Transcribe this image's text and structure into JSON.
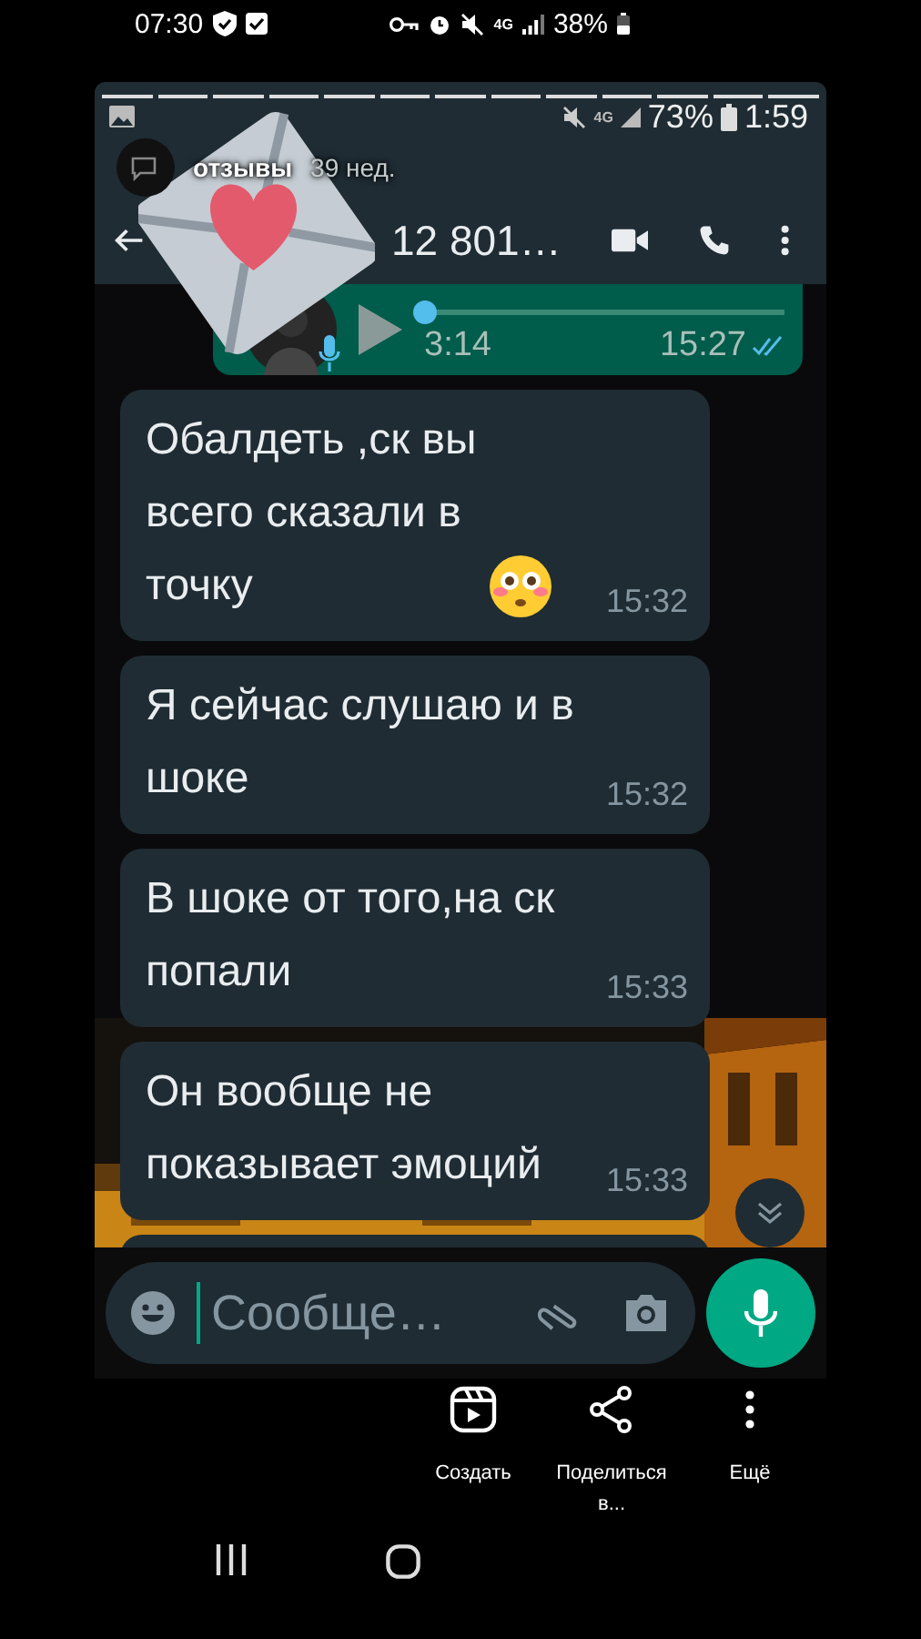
{
  "phone_status_bar": {
    "time": "07:30",
    "network": "4G",
    "battery": "38%"
  },
  "story": {
    "status_bar": {
      "network": "4G",
      "battery": "73%",
      "time": "1:59"
    },
    "author": "отзывы",
    "age": "39 нед."
  },
  "chat": {
    "contact": "12 801…",
    "voice_message": {
      "level": 0,
      "duration": "3:14",
      "time": "15:27",
      "read": true
    },
    "messages": [
      {
        "text": "Обалдеть ,ск вы\nвсего сказали в\nточку",
        "emoji": true,
        "time": "15:32"
      },
      {
        "text": "Я сейчас слушаю и в\nшоке",
        "emoji": false,
        "time": "15:32"
      },
      {
        "text": "В шоке от того,на ск\nпопали",
        "emoji": false,
        "time": "15:33"
      },
      {
        "text": "Он вообще не\nпоказывает эмоций",
        "emoji": false,
        "time": "15:33"
      }
    ],
    "input": {
      "placeholder": "Сообще…"
    }
  },
  "actions": [
    {
      "kind": "create",
      "label": "Создать"
    },
    {
      "kind": "share",
      "label": "Поделиться в..."
    },
    {
      "kind": "more",
      "label": "Ещё"
    }
  ]
}
